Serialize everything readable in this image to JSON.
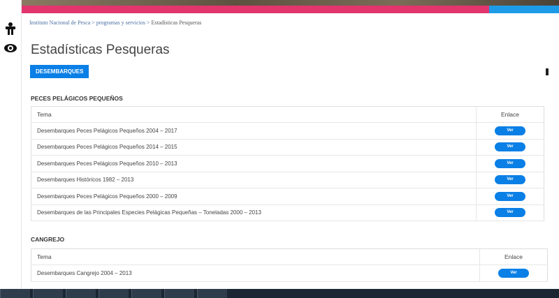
{
  "breadcrumb": {
    "root": "Instituto Nacional de Pesca",
    "sep1": " > ",
    "section": "programas y servicios",
    "sep2": " > ",
    "current": "Estadísticas Pesqueras"
  },
  "page": {
    "title": "Estadísticas Pesqueras",
    "tab_label": "DESEMBARQUES"
  },
  "sections": [
    {
      "heading": "PECES PELÁGICOS PEQUEÑOS",
      "columns": [
        "Tema",
        "Enlace"
      ],
      "rows": [
        {
          "tema": "Desembarques Peces Pelágicos Pequeños 2004 – 2017",
          "link": "Ver"
        },
        {
          "tema": "Desembarques Peces Pelágicos Pequeños 2014 – 2015",
          "link": "Ver"
        },
        {
          "tema": "Desembarques Peces Pelágicos Pequeños 2010 – 2013",
          "link": "Ver"
        },
        {
          "tema": "Desembarques Históricos 1982 – 2013",
          "link": "Ver"
        },
        {
          "tema": "Desembarques Peces Pelágicos Pequeños 2000 – 2009",
          "link": "Ver"
        },
        {
          "tema": "Desembarques de las Principales Especies Pelágicas Pequeñas – Toneladas 2000 – 2013",
          "link": "Ver"
        }
      ]
    },
    {
      "heading": "CANGREJO",
      "columns": [
        "Tema",
        "Enlace"
      ],
      "rows": [
        {
          "tema": "Desembarques Cangrejo 2004 – 2013",
          "link": "Ver"
        }
      ]
    }
  ],
  "colors": {
    "accent_blue": "#0a7fe6",
    "bar_pink": "#e2356e",
    "bar_blue": "#1e9be6"
  }
}
